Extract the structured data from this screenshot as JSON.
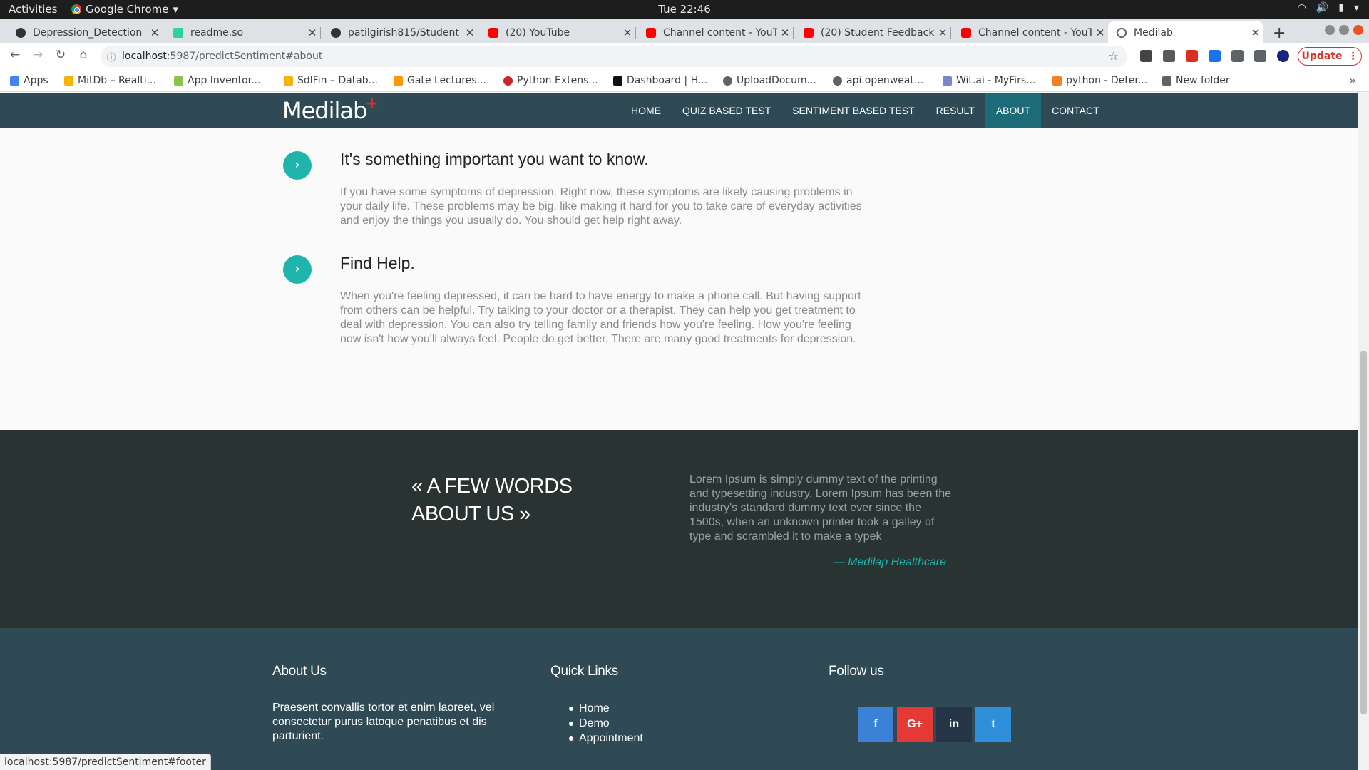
{
  "system": {
    "activities": "Activities",
    "app_name": "Google Chrome",
    "clock": "Tue 22:46"
  },
  "tabs": [
    {
      "title": "Depression_Detection",
      "favicon": "github-icon"
    },
    {
      "title": "readme.so",
      "favicon": "readme-icon"
    },
    {
      "title": "patilgirish815/Student",
      "favicon": "github-icon"
    },
    {
      "title": "(20) YouTube",
      "favicon": "youtube-icon"
    },
    {
      "title": "Channel content - YouT",
      "favicon": "youtube-icon"
    },
    {
      "title": "(20) Student Feedback",
      "favicon": "youtube-icon"
    },
    {
      "title": "Channel content - YouT",
      "favicon": "youtube-icon"
    },
    {
      "title": "Medilab",
      "favicon": "globe-icon",
      "active": true
    }
  ],
  "address_bar": {
    "host": "localhost",
    "path": ":5987/predictSentiment#about",
    "update_label": "Update"
  },
  "bookmarks": [
    {
      "label": "Apps",
      "color": "#4285f4"
    },
    {
      "label": "MitDb – Realti...",
      "color": "#f4b400"
    },
    {
      "label": "App Inventor...",
      "color": "#8bc34a"
    },
    {
      "label": "SdlFin – Datab...",
      "color": "#f4b400"
    },
    {
      "label": "Gate Lectures...",
      "color": "#ff9800"
    },
    {
      "label": "Python Extens...",
      "color": "#c62828"
    },
    {
      "label": "Dashboard | H...",
      "color": "#111111"
    },
    {
      "label": "UploadDocum...",
      "color": "#5f6368"
    },
    {
      "label": "api.openweat...",
      "color": "#5f6368"
    },
    {
      "label": "Wit.ai - MyFirs...",
      "color": "#7986cb"
    },
    {
      "label": "python - Deter...",
      "color": "#f48024"
    },
    {
      "label": "New folder",
      "color": "#5f6368"
    }
  ],
  "site": {
    "logo": "Medilab",
    "logo_plus": "+",
    "nav": [
      "HOME",
      "QUIZ BASED TEST",
      "SENTIMENT BASED TEST",
      "RESULT",
      "ABOUT",
      "CONTACT"
    ],
    "nav_active": "ABOUT",
    "features": [
      {
        "title": "It's something important you want to know.",
        "text": "If you have some symptoms of depression. Right now, these symptoms are likely causing problems in your daily life. These problems may be big, like making it hard for you to take care of everyday activities and enjoy the things you usually do. You should get help right away."
      },
      {
        "title": "Find Help.",
        "text": "When you're feeling depressed, it can be hard to have energy to make a phone call. But having support from others can be helpful. Try talking to your doctor or a therapist. They can help you get treatment to deal with depression. You can also try telling family and friends how you're feeling. How you're feeling now isn't how you'll always feel. People do get better. There are many good treatments for depression."
      }
    ],
    "about_quote": {
      "title_line1": "« A FEW WORDS",
      "title_line2": "ABOUT US »",
      "text": "Lorem Ipsum is simply dummy text of the printing and typesetting industry. Lorem Ipsum has been the industry's standard dummy text ever since the 1500s, when an unknown printer took a galley of type and scrambled it to make a typek",
      "author": "— Medilap Healthcare"
    },
    "footer": {
      "about_title": "About Us",
      "about_text": "Praesent convallis tortor et enim laoreet, vel consectetur purus latoque penatibus et dis parturient.",
      "links_title": "Quick Links",
      "links": [
        "Home",
        "Demo",
        "Appointment"
      ],
      "follow_title": "Follow us",
      "social": [
        {
          "glyph": "f",
          "name": "facebook-icon",
          "color": "#3b82d6"
        },
        {
          "glyph": "G+",
          "name": "google-plus-icon",
          "color": "#e53935"
        },
        {
          "glyph": "in",
          "name": "linkedin-icon",
          "color": "#263447"
        },
        {
          "glyph": "t",
          "name": "twitter-icon",
          "color": "#2f8fd8"
        }
      ]
    }
  },
  "status_link": "localhost:5987/predictSentiment#footer"
}
